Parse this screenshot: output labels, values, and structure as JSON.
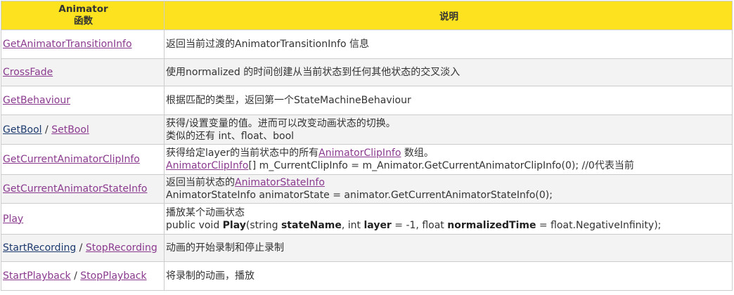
{
  "header": {
    "col1_line1": "Animator",
    "col1_line2": "函数",
    "col2": "说明"
  },
  "rows": [
    {
      "name": "GetAnimatorTransitionInfo",
      "desc": "返回当前过渡的AnimatorTransitionInfo 信息"
    },
    {
      "name": "CrossFade",
      "desc": "使用normalized 的时间创建从当前状态到任何其他状态的交叉淡入"
    },
    {
      "name": "GetBehaviour",
      "desc": "根据匹配的类型，返回第一个StateMachineBehaviour"
    },
    {
      "name_a": "GetBool",
      "sep": " / ",
      "name_b": "SetBool",
      "desc_line1": "获得/设置变量的值。进而可以改变动画状态的切换。",
      "desc_line2": "类似的还有 int、float、bool"
    },
    {
      "name": "GetCurrentAnimatorClipInfo",
      "desc_line1_pre": "获得给定layer的当前状态中的所有",
      "desc_line1_link": "AnimatorClipInfo",
      "desc_line1_post": " 数组。",
      "desc_line2_link": "AnimatorClipInfo",
      "desc_line2_post": "[] m_CurrentClipInfo =  m_Animator.GetCurrentAnimatorClipInfo(0); //0代表当前"
    },
    {
      "name": "GetCurrentAnimatorStateInfo",
      "desc_line1_pre": "返回当前状态的",
      "desc_line1_link": "AnimatorStateInfo",
      "desc_line2": "AnimatorStateInfo animatorState = animator.GetCurrentAnimatorStateInfo(0);"
    },
    {
      "name": "Play",
      "desc_line1": "播放某个动画状态",
      "sig_1": "public void ",
      "sig_play": "Play",
      "sig_2": "(string ",
      "sig_state": "stateName",
      "sig_3": ", int ",
      "sig_layer": "layer",
      "sig_4": " = -1, float ",
      "sig_norm": "normalizedTime",
      "sig_5": " = float.NegativeInfinity);"
    },
    {
      "name_a": "StartRecording",
      "sep": " / ",
      "name_b": "StopRecording",
      "desc": "动画的开始录制和停止录制"
    },
    {
      "name_a": "StartPlayback",
      "sep": " / ",
      "name_b": "StopPlayback",
      "desc": "将录制的动画，播放"
    }
  ],
  "colors": {
    "header_bg": "#fce21f",
    "link_purple": "#8a3a8e",
    "link_blue": "#1d3a6e",
    "border": "#cccccc",
    "row_alt": "#f3f3f3"
  }
}
